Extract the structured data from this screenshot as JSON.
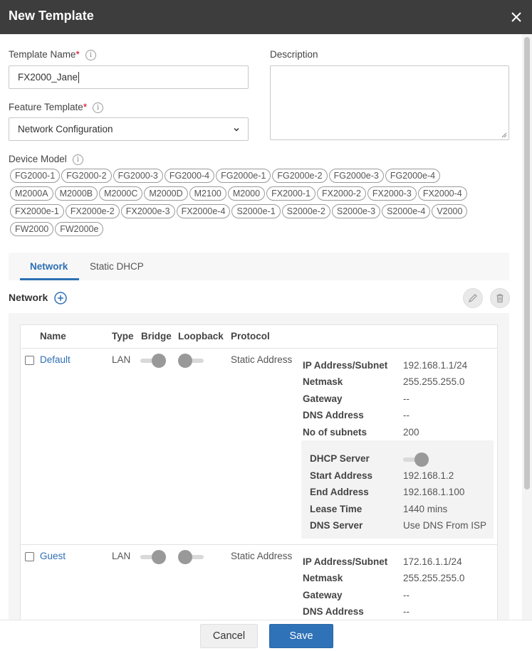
{
  "dialog": {
    "title": "New Template"
  },
  "form": {
    "template_name_label": "Template Name",
    "template_name_value": "FX2000_Jane",
    "description_label": "Description",
    "description_value": "",
    "feature_template_label": "Feature Template",
    "feature_template_value": "Network Configuration",
    "device_model_label": "Device Model",
    "required_mark": "*",
    "info_glyph": "i"
  },
  "device_models": [
    "FG2000-1",
    "FG2000-2",
    "FG2000-3",
    "FG2000-4",
    "FG2000e-1",
    "FG2000e-2",
    "FG2000e-3",
    "FG2000e-4",
    "M2000A",
    "M2000B",
    "M2000C",
    "M2000D",
    "M2100",
    "M2000",
    "FX2000-1",
    "FX2000-2",
    "FX2000-3",
    "FX2000-4",
    "FX2000e-1",
    "FX2000e-2",
    "FX2000e-3",
    "FX2000e-4",
    "S2000e-1",
    "S2000e-2",
    "S2000e-3",
    "S2000e-4",
    "V2000",
    "FW2000",
    "FW2000e"
  ],
  "tabs": [
    {
      "label": "Network",
      "active": true
    },
    {
      "label": "Static DHCP",
      "active": false
    }
  ],
  "network_section": {
    "title": "Network"
  },
  "table": {
    "headers": {
      "name": "Name",
      "type": "Type",
      "bridge": "Bridge",
      "loopback": "Loopback",
      "protocol": "Protocol"
    },
    "rows": [
      {
        "name": "Default",
        "type": "LAN",
        "bridge_on": true,
        "loopback_on": false,
        "protocol": "Static Address",
        "details": [
          {
            "key": "IP Address/Subnet",
            "value": "192.168.1.1/24"
          },
          {
            "key": "Netmask",
            "value": "255.255.255.0"
          },
          {
            "key": "Gateway",
            "value": "--"
          },
          {
            "key": "DNS Address",
            "value": "--"
          },
          {
            "key": "No of subnets",
            "value": "200"
          }
        ],
        "dhcp": [
          {
            "key": "DHCP Server",
            "value": ""
          },
          {
            "key": "Start Address",
            "value": "192.168.1.2"
          },
          {
            "key": "End Address",
            "value": "192.168.1.100"
          },
          {
            "key": "Lease Time",
            "value": "1440 mins"
          },
          {
            "key": "DNS Server",
            "value": "Use DNS From ISP"
          }
        ],
        "dhcp_server_on": true
      },
      {
        "name": "Guest",
        "type": "LAN",
        "bridge_on": true,
        "loopback_on": false,
        "protocol": "Static Address",
        "details": [
          {
            "key": "IP Address/Subnet",
            "value": "172.16.1.1/24"
          },
          {
            "key": "Netmask",
            "value": "255.255.255.0"
          },
          {
            "key": "Gateway",
            "value": "--"
          },
          {
            "key": "DNS Address",
            "value": "--"
          }
        ]
      }
    ]
  },
  "footer": {
    "cancel_label": "Cancel",
    "save_label": "Save"
  },
  "colors": {
    "accent": "#2f72b8",
    "link": "#2d6fb4",
    "header_bg": "#3d3d3d",
    "required": "#d0021b"
  }
}
